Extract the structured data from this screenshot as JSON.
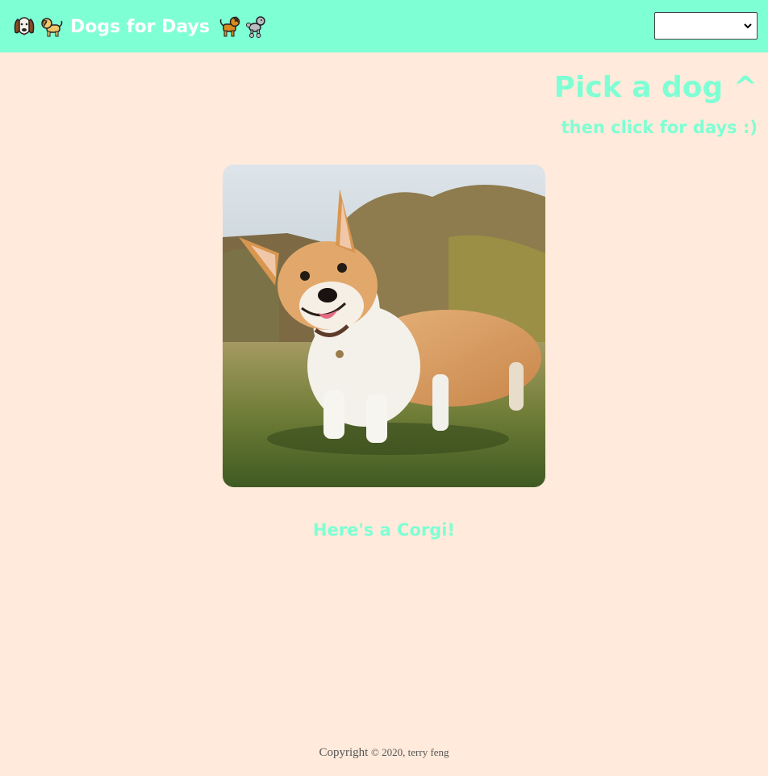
{
  "header": {
    "title": "Dogs for Days",
    "emoji_left": [
      "hound-face-icon",
      "puppy-icon"
    ],
    "emoji_right": [
      "dog-icon",
      "poodle-icon"
    ],
    "breed_select": {
      "selected": ""
    }
  },
  "main": {
    "heading": "Pick a dog ^",
    "subheading": "then click for days :)",
    "image_subject": "corgi",
    "caption": "Here's a Corgi!"
  },
  "footer": {
    "copyright_word": "Copyright",
    "rest": "© 2020, terry feng"
  },
  "colors": {
    "header_bg": "#7fffd4",
    "page_bg": "#ffeadb",
    "accent_text": "#7fffd4"
  }
}
